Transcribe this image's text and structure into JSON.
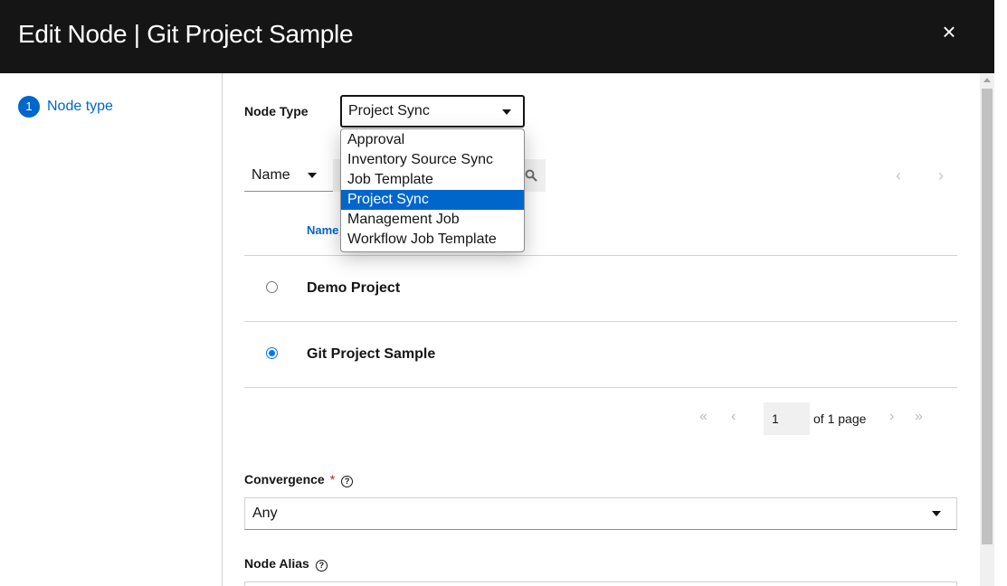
{
  "header": {
    "title": "Edit Node | Git Project Sample",
    "close_icon": "×"
  },
  "nav": {
    "steps": [
      {
        "number": "1",
        "label": "Node type"
      }
    ]
  },
  "node_type": {
    "label": "Node Type",
    "selected": "Project Sync",
    "options": [
      "Approval",
      "Inventory Source Sync",
      "Job Template",
      "Project Sync",
      "Management Job",
      "Workflow Job Template"
    ],
    "highlighted_index": 3
  },
  "toolbar": {
    "filter_by": "Name"
  },
  "table": {
    "column_header": "Name",
    "rows": [
      {
        "name": "Demo Project",
        "selected": false
      },
      {
        "name": "Git Project Sample",
        "selected": true
      }
    ]
  },
  "pagination": {
    "page": "1",
    "of_label": "of 1 page"
  },
  "convergence": {
    "label": "Convergence",
    "required_mark": "*",
    "value": "Any"
  },
  "node_alias": {
    "label": "Node Alias"
  },
  "icons": {
    "help": "?",
    "search": "search-icon",
    "close": "close-icon"
  },
  "colors": {
    "header_bg": "#151515",
    "accent": "#0066cc",
    "required": "#c9190b"
  }
}
